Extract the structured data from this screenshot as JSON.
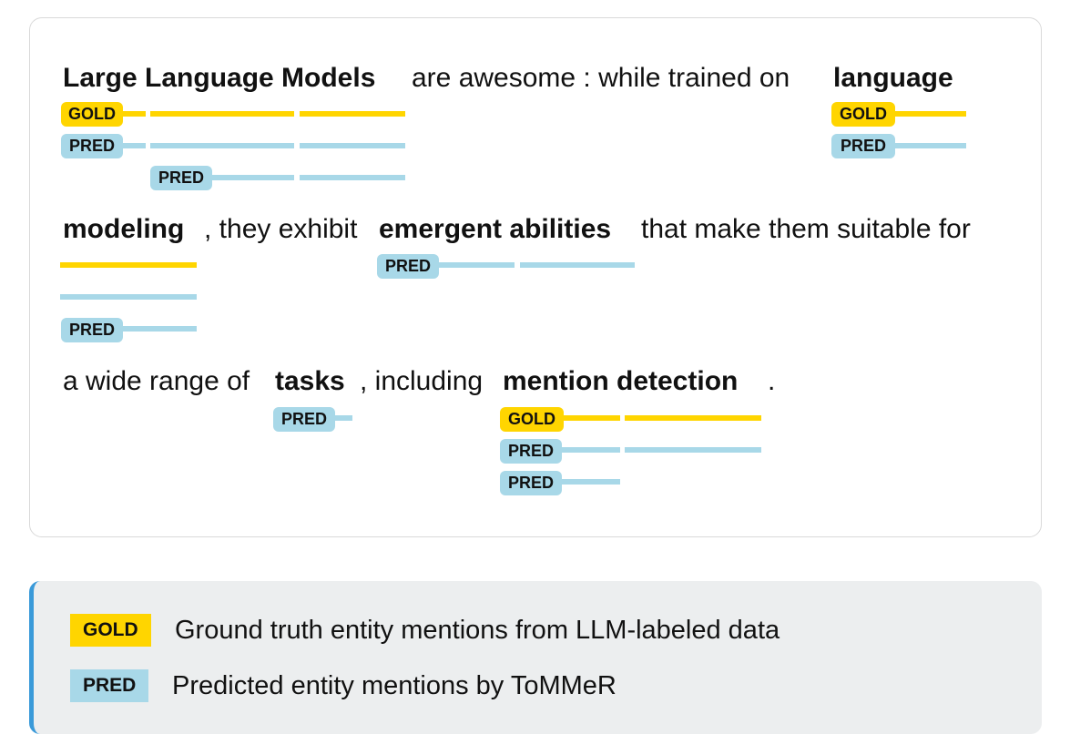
{
  "tokens": [
    {
      "text": "Large Language Models",
      "bold": true
    },
    {
      "text": "are awesome : while trained on",
      "bold": false
    },
    {
      "text": "language",
      "bold": true
    },
    {
      "text": "modeling",
      "bold": true
    },
    {
      "text": ", they exhibit",
      "bold": false
    },
    {
      "text": "emergent abilities",
      "bold": true
    },
    {
      "text": "that make them suitable for",
      "bold": false
    },
    {
      "text": "a wide range of",
      "bold": false
    },
    {
      "text": "tasks",
      "bold": true
    },
    {
      "text": ", including",
      "bold": false
    },
    {
      "text": "mention detection",
      "bold": true
    },
    {
      "text": ".",
      "bold": false
    }
  ],
  "tags": {
    "gold": "GOLD",
    "pred": "PRED"
  },
  "legend": {
    "gold_label": "GOLD",
    "gold_text": "Ground truth entity mentions from LLM-labeled data",
    "pred_label": "PRED",
    "pred_text": "Predicted entity mentions by ToMMeR"
  },
  "colors": {
    "gold": "#ffd500",
    "pred": "#a8d8e8",
    "legend_accent": "#3a9ad9"
  }
}
